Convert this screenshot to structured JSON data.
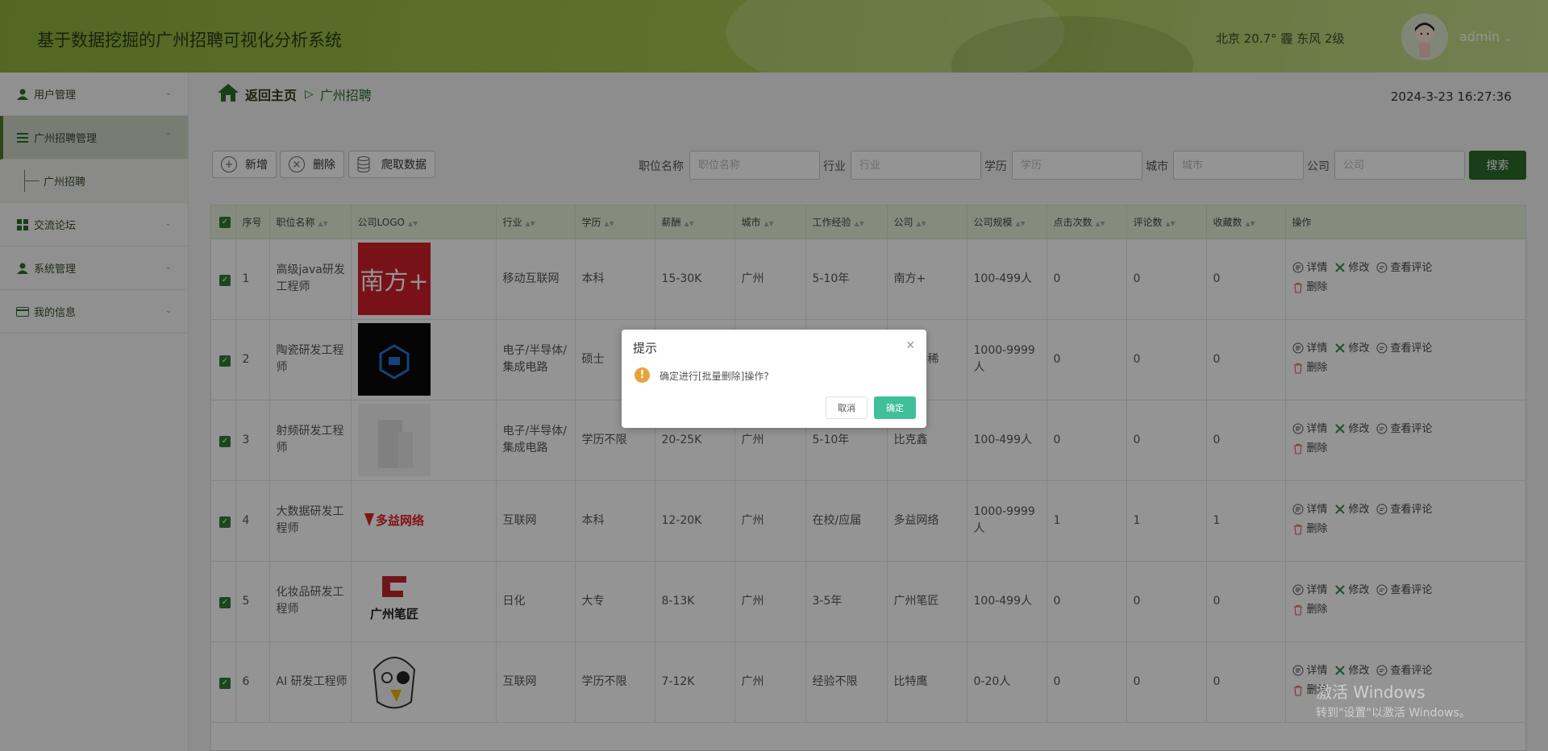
{
  "header": {
    "title": "基于数据挖掘的广州招聘可视化分析系统",
    "weather": "北京  20.7°  霾 东风  2级",
    "user": "admin"
  },
  "sidebar": {
    "items": [
      {
        "label": "用户管理",
        "icon": "user-icon"
      },
      {
        "label": "广州招聘管理",
        "icon": "list-icon"
      },
      {
        "label": "交流论坛",
        "icon": "grid-icon"
      },
      {
        "label": "系统管理",
        "icon": "users-icon"
      },
      {
        "label": "我的信息",
        "icon": "card-icon"
      }
    ],
    "sub_item": "广州招聘"
  },
  "breadcrumb": {
    "home": "返回主页",
    "current": "广州招聘"
  },
  "clock": "2024-3-23 16:27:36",
  "toolbar": {
    "add": "新增",
    "delete": "删除",
    "crawl": "爬取数据",
    "filters": [
      {
        "label": "职位名称",
        "placeholder": "职位名称"
      },
      {
        "label": "行业",
        "placeholder": "行业"
      },
      {
        "label": "学历",
        "placeholder": "学历"
      },
      {
        "label": "城市",
        "placeholder": "城市"
      },
      {
        "label": "公司",
        "placeholder": "公司"
      }
    ],
    "search": "搜索"
  },
  "table": {
    "headers": [
      "序号",
      "职位名称",
      "公司LOGO",
      "行业",
      "学历",
      "薪酬",
      "城市",
      "工作经验",
      "公司",
      "公司规模",
      "点击次数",
      "评论数",
      "收藏数",
      "操作"
    ],
    "rows": [
      {
        "no": "1",
        "title": "高级java研发工程师",
        "industry": "移动互联网",
        "edu": "本科",
        "salary": "15-30K",
        "city": "广州",
        "exp": "5-10年",
        "company": "南方+",
        "size": "100-499人",
        "clicks": "0",
        "comments": "0",
        "favs": "0"
      },
      {
        "no": "2",
        "title": "陶瓷研发工程师",
        "industry": "电子/半导体/集成电路",
        "edu": "硕士",
        "salary": "",
        "city": "",
        "exp": "",
        "company": "东先导稀",
        "size": "1000-9999人",
        "clicks": "0",
        "comments": "0",
        "favs": "0"
      },
      {
        "no": "3",
        "title": "射频研发工程师",
        "industry": "电子/半导体/集成电路",
        "edu": "学历不限",
        "salary": "20-25K",
        "city": "广州",
        "exp": "5-10年",
        "company": "比克鑫",
        "size": "100-499人",
        "clicks": "0",
        "comments": "0",
        "favs": "0"
      },
      {
        "no": "4",
        "title": "大数据研发工程师",
        "industry": "互联网",
        "edu": "本科",
        "salary": "12-20K",
        "city": "广州",
        "exp": "在校/应届",
        "company": "多益网络",
        "size": "1000-9999人",
        "clicks": "1",
        "comments": "1",
        "favs": "1"
      },
      {
        "no": "5",
        "title": "化妆品研发工程师",
        "industry": "日化",
        "edu": "大专",
        "salary": "8-13K",
        "city": "广州",
        "exp": "3-5年",
        "company": "广州笔匠",
        "size": "100-499人",
        "clicks": "0",
        "comments": "0",
        "favs": "0"
      },
      {
        "no": "6",
        "title": "AI 研发工程师",
        "industry": "互联网",
        "edu": "学历不限",
        "salary": "7-12K",
        "city": "广州",
        "exp": "经验不限",
        "company": "比特鹰",
        "size": "0-20人",
        "clicks": "0",
        "comments": "0",
        "favs": "0"
      }
    ],
    "ops": {
      "detail": "详情",
      "edit": "修改",
      "comments": "查看评论",
      "delete": "删除"
    },
    "logos": {
      "r1": "南方+",
      "r4": "多益网络",
      "r5": "广州笔匠"
    }
  },
  "dialog": {
    "title": "提示",
    "message": "确定进行[批量删除]操作?",
    "cancel": "取消",
    "confirm": "确定"
  },
  "watermark": {
    "line1": "激活 Windows",
    "line2": "转到\"设置\"以激活 Windows。"
  },
  "colors": {
    "primary": "#2e6b2a",
    "header": "#9cc047",
    "confirm": "#3fbf9a",
    "warning": "#e6a23c"
  }
}
